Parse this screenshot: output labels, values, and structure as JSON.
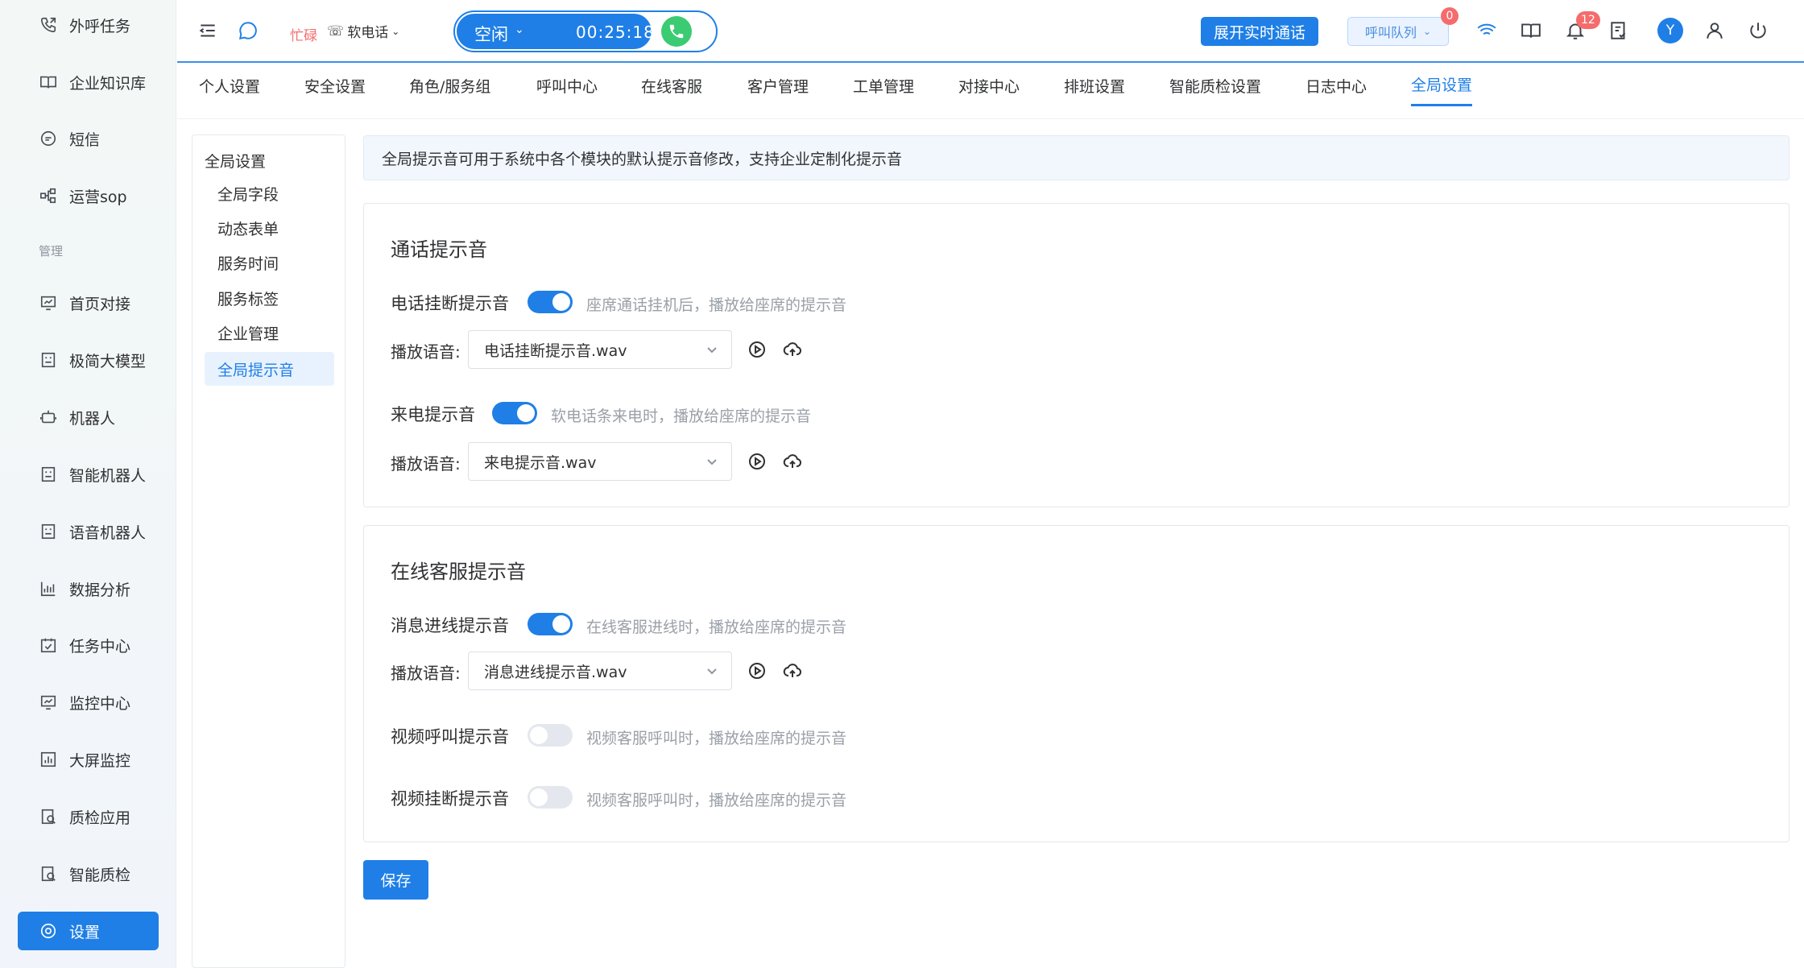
{
  "sidebar": {
    "items_top": [
      {
        "label": "外呼任务",
        "icon": "phone-out-icon"
      },
      {
        "label": "企业知识库",
        "icon": "book-icon"
      },
      {
        "label": "短信",
        "icon": "sms-icon"
      },
      {
        "label": "运营sop",
        "icon": "flow-icon"
      }
    ],
    "section_label": "管理",
    "items": [
      {
        "label": "首页对接",
        "icon": "monitor-chart-icon"
      },
      {
        "label": "极简大模型",
        "icon": "ai-model-icon"
      },
      {
        "label": "机器人",
        "icon": "robot-icon"
      },
      {
        "label": "智能机器人",
        "icon": "smart-robot-icon"
      },
      {
        "label": "语音机器人",
        "icon": "voice-robot-icon"
      },
      {
        "label": "数据分析",
        "icon": "bar-chart-icon"
      },
      {
        "label": "任务中心",
        "icon": "calendar-check-icon"
      },
      {
        "label": "监控中心",
        "icon": "monitor-icon"
      },
      {
        "label": "大屏监控",
        "icon": "screen-chart-icon"
      },
      {
        "label": "质检应用",
        "icon": "quality-app-icon"
      },
      {
        "label": "智能质检",
        "icon": "smart-quality-icon"
      },
      {
        "label": "设置",
        "icon": "gear-icon"
      }
    ]
  },
  "topbar": {
    "busy_label": "忙碌",
    "softphone_label": "软电话",
    "status_label": "空闲",
    "timer": "00:25:18",
    "expand_label": "展开实时通话",
    "queue_label": "呼叫队列",
    "queue_badge": "0",
    "notify_badge": "12",
    "avatar_letter": "Y"
  },
  "tabs": [
    "个人设置",
    "安全设置",
    "角色/服务组",
    "呼叫中心",
    "在线客服",
    "客户管理",
    "工单管理",
    "对接中心",
    "排班设置",
    "智能质检设置",
    "日志中心",
    "全局设置"
  ],
  "subnav": {
    "title": "全局设置",
    "items": [
      "全局字段",
      "动态表单",
      "服务时间",
      "服务标签",
      "企业管理",
      "全局提示音"
    ]
  },
  "info": "全局提示音可用于系统中各个模块的默认提示音修改，支持企业定制化提示音",
  "play_label": "播放语音:",
  "call_card": {
    "title": "通话提示音",
    "hangup": {
      "label": "电话挂断提示音",
      "hint": "座席通话挂机后，播放给座席的提示音",
      "on": true,
      "file": "电话挂断提示音.wav"
    },
    "incoming": {
      "label": "来电提示音",
      "hint": "软电话条来电时，播放给座席的提示音",
      "on": true,
      "file": "来电提示音.wav"
    }
  },
  "online_card": {
    "title": "在线客服提示音",
    "message": {
      "label": "消息进线提示音",
      "hint": "在线客服进线时，播放给座席的提示音",
      "on": true,
      "file": "消息进线提示音.wav"
    },
    "video_call": {
      "label": "视频呼叫提示音",
      "hint": "视频客服呼叫时，播放给座席的提示音",
      "on": false
    },
    "video_hangup": {
      "label": "视频挂断提示音",
      "hint": "视频客服呼叫时，播放给座席的提示音",
      "on": false
    }
  },
  "save_label": "保存",
  "colors": {
    "accent": "#1f7fe6",
    "danger": "#f56c6c",
    "success": "#3bcb73"
  }
}
